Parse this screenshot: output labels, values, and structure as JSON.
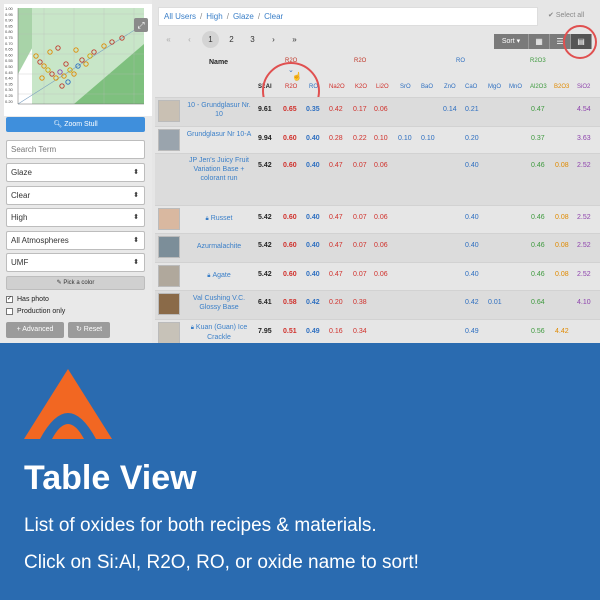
{
  "breadcrumb": [
    "All Users",
    "High",
    "Glaze",
    "Clear"
  ],
  "select_all": "Select all",
  "expand_icon": "expand-icon",
  "zoom_button": "Zoom Stull",
  "zoom_icon": "search-icon",
  "chart_ticks": [
    "1.00",
    "0.95",
    "0.90",
    "0.85",
    "0.80",
    "0.75",
    "0.70",
    "0.65",
    "0.60",
    "0.55",
    "0.50",
    "0.45",
    "0.40",
    "0.35",
    "0.30",
    "0.25",
    "0.20"
  ],
  "filters": {
    "search_placeholder": "Search Term",
    "type": "Glaze",
    "subtype": "Clear",
    "cone": "High",
    "atmosphere": "All Atmospheres",
    "analysis": "UMF"
  },
  "pick_color": "Pick a color",
  "has_photo": "Has photo",
  "production_only": "Production only",
  "advanced": "Advanced",
  "reset": "Reset",
  "pager": [
    "«",
    "‹",
    "1",
    "2",
    "3",
    "›",
    "»"
  ],
  "sort_button": "Sort",
  "header": {
    "name": "Name",
    "sial": "Si:Al",
    "r2o_group": "R2O",
    "ro_group": "RO",
    "r2o3_group": "R2O3",
    "r2o_col": "R2O",
    "ro_col": "RO",
    "oxides": [
      "Na2O",
      "K2O",
      "Li2O",
      "SrO",
      "BaO",
      "ZnO",
      "CaO",
      "MgO",
      "MnO",
      "Al2O3",
      "B2O3",
      "SiO2"
    ]
  },
  "rows": [
    {
      "name": "10 - Grundglasur Nr. 10",
      "locked": false,
      "sial": "9.61",
      "r2o": "0.65",
      "ro": "0.35",
      "na2o": "0.42",
      "k2o": "0.17",
      "li2o": "0.06",
      "sro": "",
      "bao": "",
      "zno": "0.14",
      "cao": "0.21",
      "mgo": "",
      "mno": "",
      "al2o3": "0.47",
      "b2o3": "",
      "sio2": "4.54"
    },
    {
      "name": "Grundglasur Nr 10-A",
      "locked": false,
      "sial": "9.94",
      "r2o": "0.60",
      "ro": "0.40",
      "na2o": "0.28",
      "k2o": "0.22",
      "li2o": "0.10",
      "sro": "0.10",
      "bao": "0.10",
      "zno": "",
      "cao": "0.20",
      "mgo": "",
      "mno": "",
      "al2o3": "0.37",
      "b2o3": "",
      "sio2": "3.63"
    },
    {
      "name": "JP Jen's Juicy Fruit Variation Base + colorant run",
      "locked": false,
      "sial": "5.42",
      "r2o": "0.60",
      "ro": "0.40",
      "na2o": "0.47",
      "k2o": "0.07",
      "li2o": "0.06",
      "sro": "",
      "bao": "",
      "zno": "",
      "cao": "0.40",
      "mgo": "",
      "mno": "",
      "al2o3": "0.46",
      "b2o3": "0.08",
      "sio2": "2.52"
    },
    {
      "name": "Russet",
      "locked": true,
      "sial": "5.42",
      "r2o": "0.60",
      "ro": "0.40",
      "na2o": "0.47",
      "k2o": "0.07",
      "li2o": "0.06",
      "sro": "",
      "bao": "",
      "zno": "",
      "cao": "0.40",
      "mgo": "",
      "mno": "",
      "al2o3": "0.46",
      "b2o3": "0.08",
      "sio2": "2.52"
    },
    {
      "name": "Azurmalachite",
      "locked": false,
      "sial": "5.42",
      "r2o": "0.60",
      "ro": "0.40",
      "na2o": "0.47",
      "k2o": "0.07",
      "li2o": "0.06",
      "sro": "",
      "bao": "",
      "zno": "",
      "cao": "0.40",
      "mgo": "",
      "mno": "",
      "al2o3": "0.46",
      "b2o3": "0.08",
      "sio2": "2.52"
    },
    {
      "name": "Agate",
      "locked": true,
      "sial": "5.42",
      "r2o": "0.60",
      "ro": "0.40",
      "na2o": "0.47",
      "k2o": "0.07",
      "li2o": "0.06",
      "sro": "",
      "bao": "",
      "zno": "",
      "cao": "0.40",
      "mgo": "",
      "mno": "",
      "al2o3": "0.46",
      "b2o3": "0.08",
      "sio2": "2.52"
    },
    {
      "name": "Val Cushing V.C. Glossy Base",
      "locked": false,
      "sial": "6.41",
      "r2o": "0.58",
      "ro": "0.42",
      "na2o": "0.20",
      "k2o": "0.38",
      "li2o": "",
      "sro": "",
      "bao": "",
      "zno": "",
      "cao": "0.42",
      "mgo": "0.01",
      "mno": "",
      "al2o3": "0.64",
      "b2o3": "",
      "sio2": "4.10"
    },
    {
      "name": "Kuan (Guan) Ice Crackle",
      "locked": true,
      "sial": "7.95",
      "r2o": "0.51",
      "ro": "0.49",
      "na2o": "0.16",
      "k2o": "0.34",
      "li2o": "",
      "sro": "",
      "bao": "",
      "zno": "",
      "cao": "0.49",
      "mgo": "",
      "mno": "",
      "al2o3": "0.56",
      "b2o3": "4.42",
      "sio2": ""
    }
  ],
  "promo": {
    "title": "Table View",
    "line1": "List of oxides for both recipes & materials.",
    "line2": "Click on Si:Al, R2O, RO, or oxide name to sort!"
  },
  "colors": {
    "accent_blue": "#3f8fdc",
    "promo_blue": "#2a6bb0",
    "logo_orange": "#f26722",
    "highlight_red": "#e05050"
  }
}
